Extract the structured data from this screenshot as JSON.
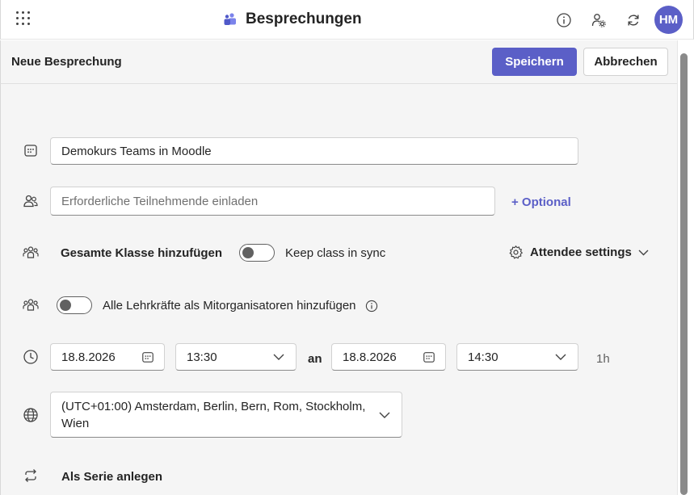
{
  "app": {
    "title": "Besprechungen"
  },
  "user": {
    "initials": "HM"
  },
  "colors": {
    "accent": "#5b5fc7"
  },
  "header": {
    "title": "Neue Besprechung",
    "save_label": "Speichern",
    "cancel_label": "Abbrechen"
  },
  "form": {
    "title_value": "Demokurs Teams in Moodle",
    "attendees_placeholder": "Erforderliche Teilnehmende einladen",
    "optional_label": "+ Optional",
    "add_class_label": "Gesamte Klasse hinzufügen",
    "keep_sync_label": "Keep class in sync",
    "keep_sync_on": false,
    "attendee_settings_label": "Attendee settings",
    "coorganizers_label": "Alle Lehrkräfte als Mitorganisatoren hinzufügen",
    "coorganizers_on": false,
    "start_date": "18.8.2026",
    "start_time": "13:30",
    "to_label": "an",
    "end_date": "18.8.2026",
    "end_time": "14:30",
    "duration": "1h",
    "timezone": "(UTC+01:00) Amsterdam, Berlin, Bern, Rom, Stockholm, Wien",
    "series_label": "Als Serie anlegen"
  },
  "icons": {
    "waffle": "app-launcher-icon",
    "app": "teams-people-icon",
    "info": "info-icon",
    "people": "people-settings-icon",
    "refresh": "refresh-icon",
    "calendar_title": "calendar-icon",
    "attendees": "people-icon",
    "class": "group-icon",
    "coorganizers": "group-icon",
    "time": "clock-icon",
    "timezone": "globe-icon",
    "series": "repeat-icon",
    "settings": "gear-icon",
    "chevron": "chevron-down-icon"
  }
}
